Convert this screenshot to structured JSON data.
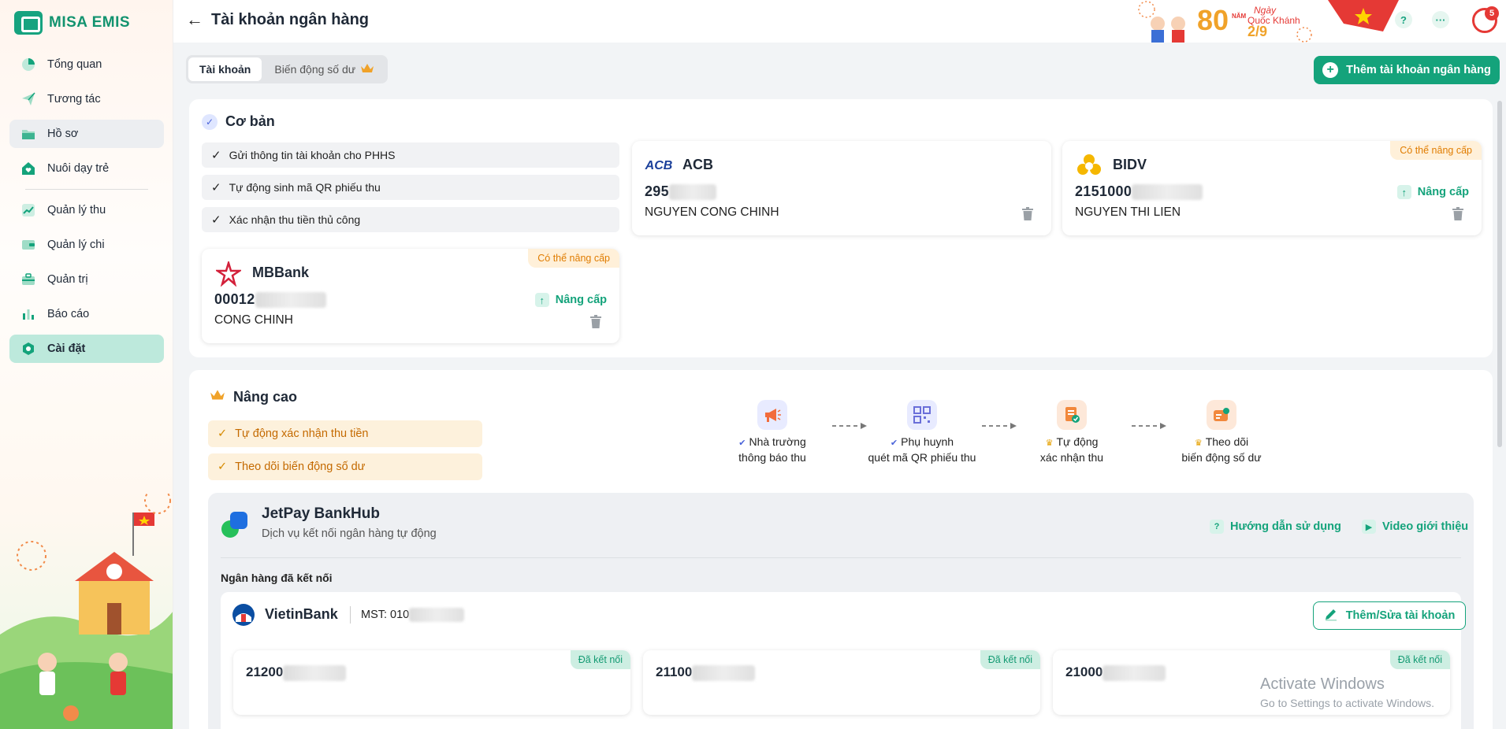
{
  "app": {
    "logo_text": "MISA EMIS",
    "page_title": "Tài khoản ngân hàng"
  },
  "sidebar": {
    "items": [
      {
        "label": "Tổng quan",
        "icon": "pie-chart-icon"
      },
      {
        "label": "Tương tác",
        "icon": "paper-plane-icon"
      },
      {
        "label": "Hồ sơ",
        "icon": "folder-icon"
      },
      {
        "label": "Nuôi dạy trẻ",
        "icon": "house-heart-icon"
      },
      {
        "label": "Quản lý thu",
        "icon": "trend-up-icon"
      },
      {
        "label": "Quản lý chi",
        "icon": "wallet-icon"
      },
      {
        "label": "Quản trị",
        "icon": "briefcase-icon"
      },
      {
        "label": "Báo cáo",
        "icon": "bar-chart-icon"
      },
      {
        "label": "Cài đặt",
        "icon": "gear-icon"
      }
    ]
  },
  "header": {
    "banner": {
      "number": "80",
      "line1": "Ngày",
      "line2": "Quốc Khánh",
      "date": "2/9",
      "small": "NĂM"
    },
    "help": "?",
    "more": "···",
    "notification_count": "5"
  },
  "tabs": [
    {
      "label": "Tài khoản"
    },
    {
      "label": "Biến động số dư"
    }
  ],
  "actions": {
    "add_account": "Thêm tài khoản ngân hàng"
  },
  "basic": {
    "title": "Cơ bản",
    "features": [
      "Gửi thông tin tài khoản cho PHHS",
      "Tự động sinh mã QR phiếu thu",
      "Xác nhận thu tiền thủ công"
    ],
    "accounts": [
      {
        "bank": "ACB",
        "number": "295",
        "holder": "NGUYEN CONG CHINH"
      },
      {
        "bank": "BIDV",
        "number": "2151000",
        "holder": "NGUYEN THI LIEN",
        "ribbon": "Có thể nâng cấp",
        "upgrade": "Nâng cấp"
      },
      {
        "bank": "MBBank",
        "number": "00012",
        "holder": "CONG CHINH",
        "ribbon": "Có thể nâng cấp",
        "upgrade": "Nâng cấp"
      }
    ]
  },
  "advanced": {
    "title": "Nâng cao",
    "features": [
      "Tự động xác nhận thu tiền",
      "Theo dõi biến động số dư"
    ],
    "flow": [
      {
        "line1": "Nhà trường",
        "line2": "thông báo thu",
        "badge": "check"
      },
      {
        "line1": "Phụ huynh",
        "line2": "quét mã QR phiếu thu",
        "badge": "check"
      },
      {
        "line1": "Tự động",
        "line2": "xác nhận thu",
        "badge": "crown"
      },
      {
        "line1": "Theo dõi",
        "line2": "biến động số dư",
        "badge": "crown"
      }
    ],
    "jetpay": {
      "title": "JetPay BankHub",
      "subtitle": "Dịch vụ kết nối ngân hàng tự động",
      "guide": "Hướng dẫn sử dụng",
      "video": "Video giới thiệu",
      "connected_label": "Ngân hàng đã kết nối",
      "bank": {
        "name": "VietinBank",
        "mst": "MST: 010",
        "edit": "Thêm/Sửa tài khoản"
      },
      "accounts": [
        {
          "number": "21200",
          "status": "Đã kết nối"
        },
        {
          "number": "21100",
          "status": "Đã kết nối"
        },
        {
          "number": "21000",
          "status": "Đã kết nối"
        }
      ]
    }
  },
  "watermark": {
    "line1": "Activate Windows",
    "line2": "Go to Settings to activate Windows."
  },
  "colors": {
    "primary": "#14a37b",
    "active_nav": "#bde9dc",
    "upgrade_ribbon": "#fff0d9",
    "connected_ribbon": "#cdeee2"
  }
}
